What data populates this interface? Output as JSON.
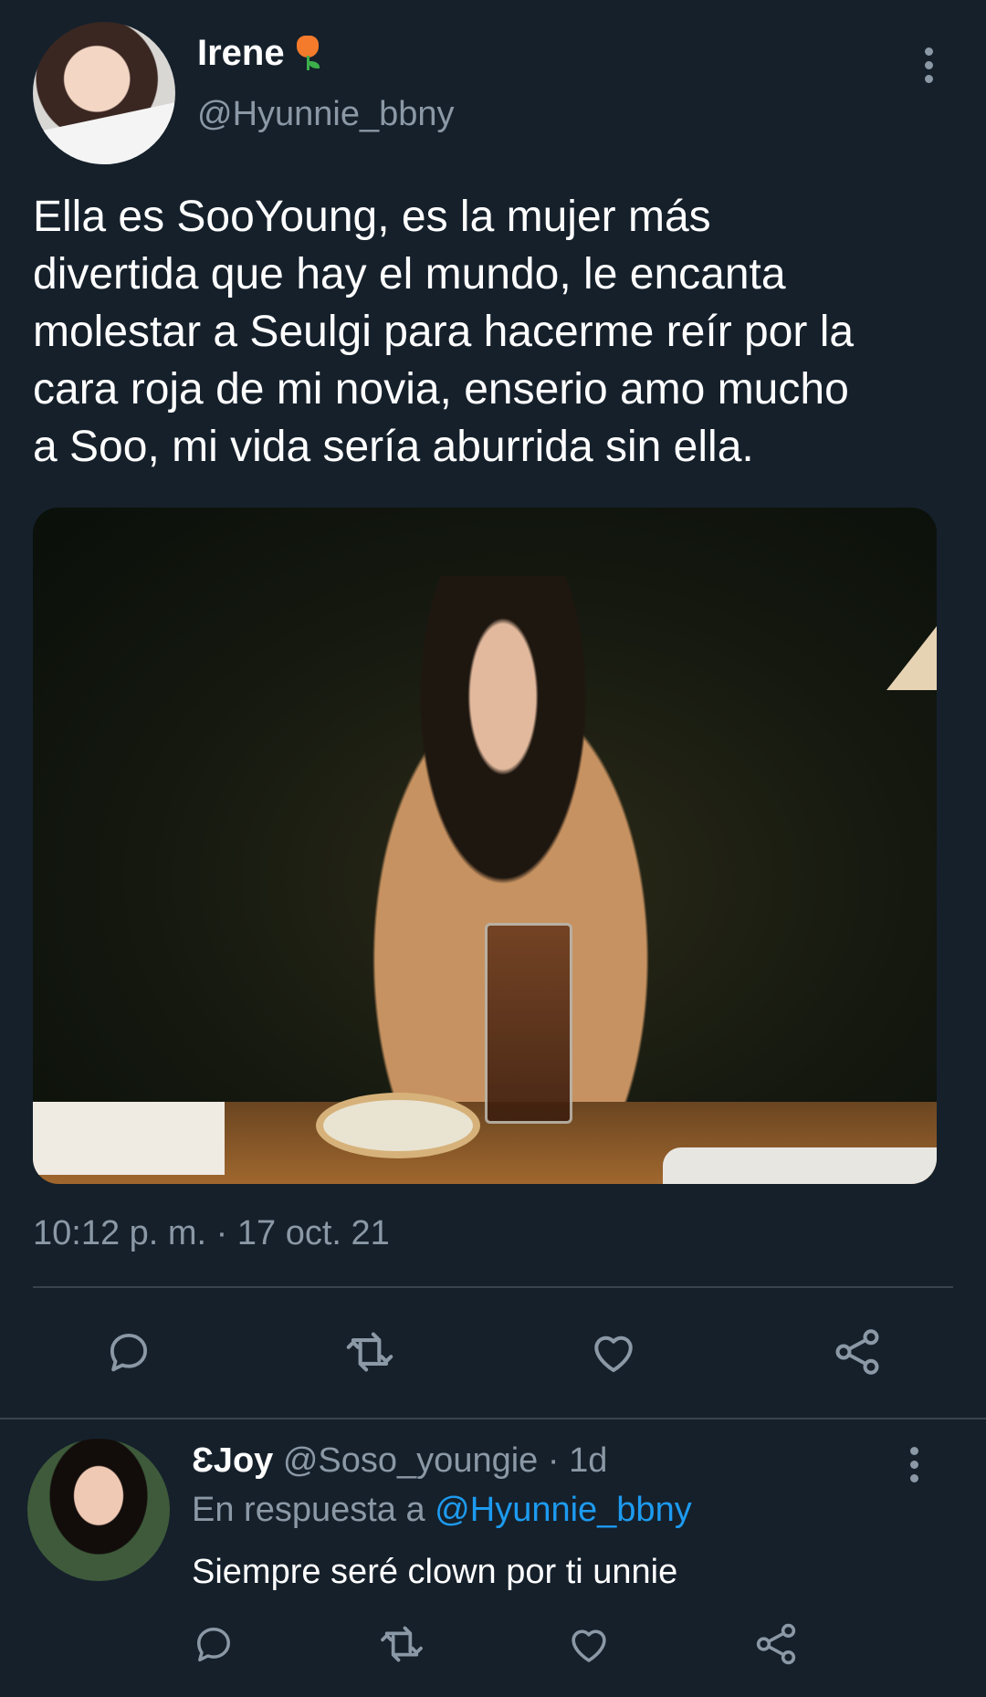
{
  "tweet": {
    "display_name": "Irene",
    "name_emoji_icon": "tulip-icon",
    "handle": "@Hyunnie_bbny",
    "text_lines": [
      "Ella es SooYoung, es la mujer más",
      "divertida que hay el mundo, le encanta",
      "molestar a Seulgi para hacerme reír por la",
      "cara roja de mi novia, enserio amo mucho",
      "a Soo, mi vida sería aburrida sin ella."
    ],
    "timestamp": "10:12 p. m. · 17 oct. 21",
    "actions": [
      "reply-icon",
      "retweet-icon",
      "like-icon",
      "share-icon"
    ]
  },
  "reply": {
    "display_name": "ƐJoy",
    "handle": "@Soso_youngie",
    "separator": " · ",
    "age": "1d",
    "context_prefix": "En respuesta a ",
    "context_mention": "@Hyunnie_bbny",
    "text": "Siempre seré clown por ti unnie",
    "actions": [
      "reply-icon",
      "retweet-icon",
      "like-icon",
      "share-icon"
    ]
  },
  "colors": {
    "background": "#15202b",
    "secondary_text": "#8b98a5",
    "mention": "#1d9bf0",
    "divider": "#38444d"
  }
}
